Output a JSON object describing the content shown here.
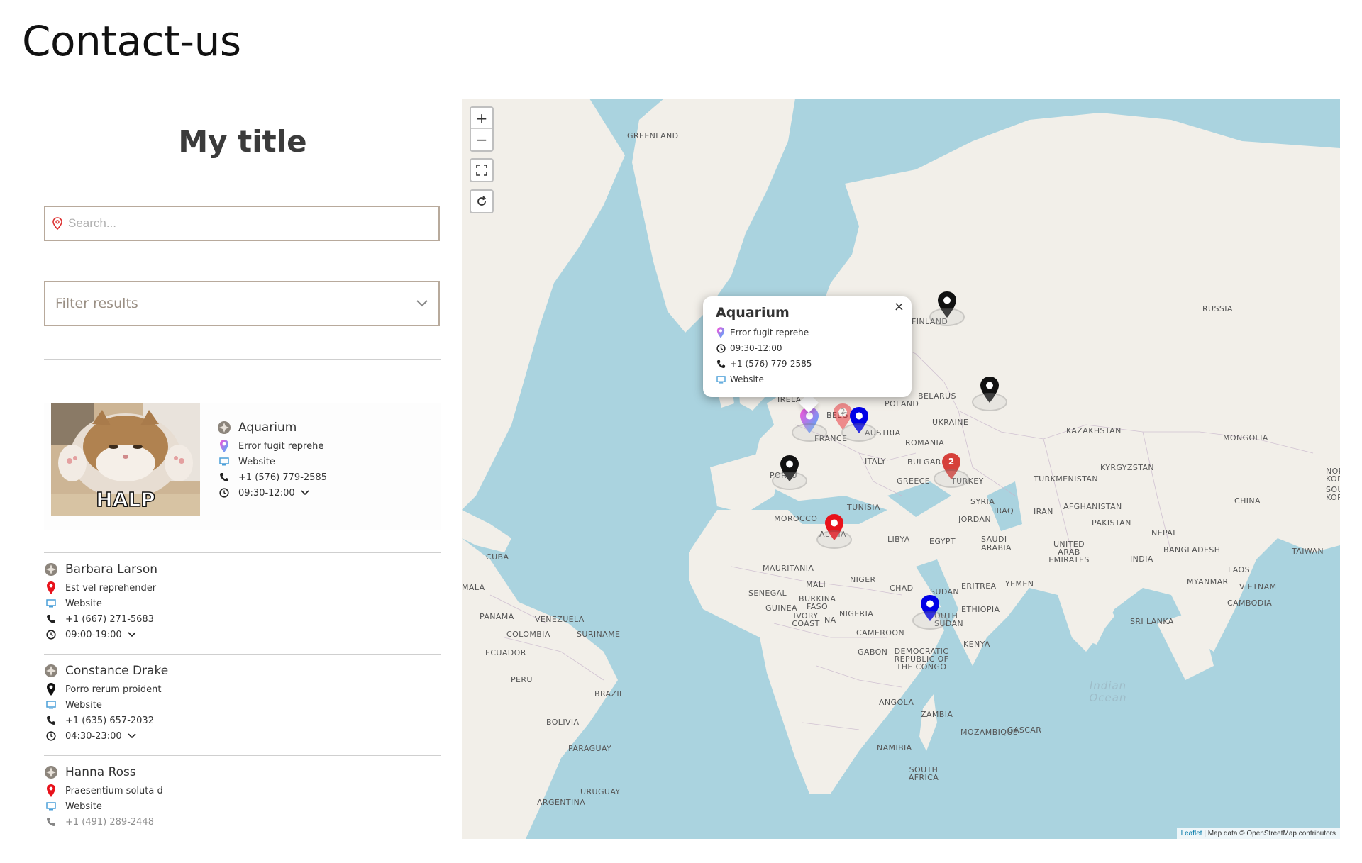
{
  "page": {
    "title": "Contact-us"
  },
  "panel": {
    "title": "My title",
    "search_placeholder": "Search...",
    "filter_label": "Filter results"
  },
  "featured": {
    "name": "Aquarium",
    "address": "Error fugit reprehe",
    "website": "Website",
    "phone": "+1 (576) 779-2585",
    "hours": "09:30-12:00",
    "image_caption": "HALP"
  },
  "entries": [
    {
      "name": "Barbara Larson",
      "address": "Est vel reprehender",
      "website": "Website",
      "phone": "+1 (667) 271-5683",
      "hours": "09:00-19:00",
      "pin_color": "#e8121b"
    },
    {
      "name": "Constance Drake",
      "address": "Porro rerum proident",
      "website": "Website",
      "phone": "+1 (635) 657-2032",
      "hours": "04:30-23:00",
      "pin_color": "#111111"
    },
    {
      "name": "Hanna Ross",
      "address": "Praesentium soluta d",
      "website": "Website",
      "phone": "+1 (491) 289-2448",
      "hours": "",
      "pin_color": "#e8121b"
    }
  ],
  "map": {
    "zoom_in": "+",
    "zoom_out": "−",
    "labels": {
      "greenland": "GREENLAND",
      "finland": "FINLAND",
      "russia": "RUSSIA",
      "ireland": "IRELA",
      "belgium": "BELG",
      "poland": "POLAND",
      "belarus": "BELARUS",
      "ukraine": "UKRAINE",
      "kazakhstan": "KAZAKHSTAN",
      "mongolia": "MONGOLIA",
      "france": "FRANCE",
      "austria": "AUSTRIA",
      "romania": "ROMANIA",
      "portugal": "PORTU",
      "italy": "ITALY",
      "bulgaria": "BULGAR",
      "greece": "GREECE",
      "turkey": "TURKEY",
      "turkmenistan": "TURKMENISTAN",
      "kyrgyzstan": "KYRGYZSTAN",
      "china": "CHINA",
      "nkorea": "NOR KOR",
      "skorea": "SOU KOR",
      "tunisia": "TUNISIA",
      "syria": "SYRIA",
      "iraq": "IRAQ",
      "iran": "IRAN",
      "afghanistan": "AFGHANISTAN",
      "morocco": "MOROCCO",
      "algeria": "AL RIA",
      "jordan": "JORDAN",
      "pakistan": "PAKISTAN",
      "libya": "LIBYA",
      "egypt": "EGYPT",
      "saudi": "SAUDI ARABIA",
      "uae": "UNITED ARAB EMIRATES",
      "nepal": "NEPAL",
      "bangladesh": "BANGLADESH",
      "taiwan": "TAIWAN",
      "india": "INDIA",
      "cuba": "CUBA",
      "mauritania": "MAURITANIA",
      "mali": "MALI",
      "niger": "NIGER",
      "chad": "CHAD",
      "sudan": "SUDAN",
      "eritrea": "ERITREA",
      "yemen": "YEMEN",
      "laos": "LAOS",
      "myanmar": "MYANMAR",
      "vietnam": "VIETNAM",
      "mala": "MALA",
      "senegal": "SENEGAL",
      "burkina": "BURKINA FASO",
      "guinea": "GUINEA",
      "ivory": "IVORY COAST",
      "na": "NA",
      "nigeria": "NIGERIA",
      "ethiopia": "ETHIOPIA",
      "ssudan": "OUTH SUDAN",
      "cambodia": "CAMBODIA",
      "panama": "PANAMA",
      "venezuela": "VENEZUELA",
      "srilanka": "SRI LANKA",
      "colombia": "COLOMBIA",
      "suriname": "SURINAME",
      "cameroon": "CAMEROON",
      "kenya": "KENYA",
      "ecuador": "ECUADOR",
      "gabon": "GABON",
      "drc": "DEMOCRATIC REPUBLIC OF THE CONGO",
      "peru": "PERU",
      "brazil": "BRAZIL",
      "indian_ocean": "Indian Ocean",
      "angola": "ANGOLA",
      "zambia": "ZAMBIA",
      "bolivia": "BOLIVIA",
      "mozambique": "MOZAMBIQUE",
      "madagascar": "GASCAR",
      "paraguay": "PARAGUAY",
      "namibia": "NAMIBIA",
      "southafrica": "SOUTH AFRICA",
      "uruguay": "URUGUAY",
      "argentina": "ARGENTINA"
    },
    "cluster_counts": {
      "belgium": "2",
      "turkey": "2"
    },
    "attribution_leaflet": "Leaflet",
    "attribution_rest": " | Map data © OpenStreetMap contributors"
  },
  "popup": {
    "title": "Aquarium",
    "close": "×",
    "address": "Error fugit reprehe",
    "hours": "09:30-12:00",
    "phone": "+1 (576) 779-2585",
    "website": "Website"
  }
}
